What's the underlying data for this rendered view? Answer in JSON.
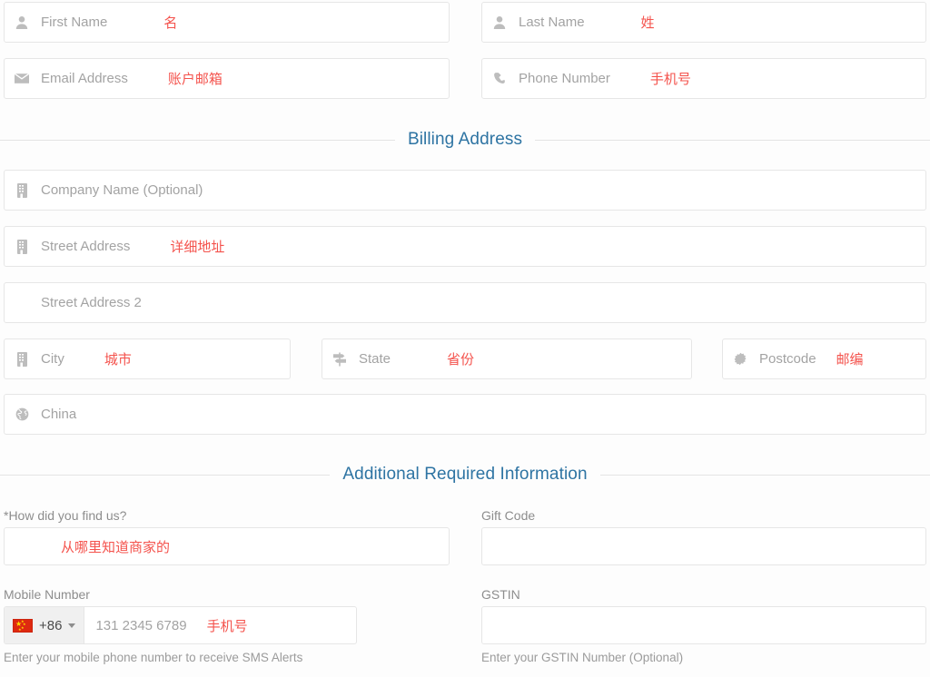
{
  "contact": {
    "first_name": {
      "icon": "user-icon",
      "placeholder": "First Name",
      "annotation": "名"
    },
    "last_name": {
      "icon": "user-icon",
      "placeholder": "Last Name",
      "annotation": "姓"
    },
    "email": {
      "icon": "envelope-icon",
      "placeholder": "Email Address",
      "annotation": "账户邮箱"
    },
    "phone": {
      "icon": "phone-icon",
      "placeholder": "Phone Number",
      "annotation": "手机号"
    }
  },
  "billing": {
    "heading": "Billing Address",
    "company": {
      "icon": "building-icon",
      "placeholder": "Company Name (Optional)",
      "annotation": ""
    },
    "street1": {
      "icon": "building-icon",
      "placeholder": "Street Address",
      "annotation": "详细地址"
    },
    "street2": {
      "icon": "none",
      "placeholder": "Street Address 2",
      "annotation": ""
    },
    "city": {
      "icon": "building-icon",
      "placeholder": "City",
      "annotation": "城市"
    },
    "state": {
      "icon": "map-signs-icon",
      "placeholder": "State",
      "annotation": "省份"
    },
    "postcode": {
      "icon": "postmark-icon",
      "placeholder": "Postcode",
      "annotation": "邮编"
    },
    "country": {
      "icon": "globe-icon",
      "value": "China",
      "annotation": ""
    }
  },
  "additional": {
    "heading": "Additional Required Information",
    "how_found": {
      "label": "*How did you find us?",
      "value": "",
      "annotation": "从哪里知道商家的",
      "help": ""
    },
    "gift_code": {
      "label": "Gift Code",
      "value": "",
      "annotation": "",
      "help": ""
    },
    "mobile": {
      "label": "Mobile Number",
      "dial_code": "+86",
      "flag": "cn-flag-icon",
      "placeholder": "131 2345 6789",
      "annotation": "手机号",
      "help": "Enter your mobile phone number to receive SMS Alerts"
    },
    "gstin": {
      "label": "GSTIN",
      "value": "",
      "annotation": "",
      "help": "Enter your GSTIN Number (Optional)"
    }
  },
  "colors": {
    "heading_blue": "#2e74a3",
    "annotation_red": "#f4534d",
    "placeholder_grey": "#a3a3a3",
    "border_grey": "#e6e6e6",
    "flag_red": "#de2910"
  }
}
